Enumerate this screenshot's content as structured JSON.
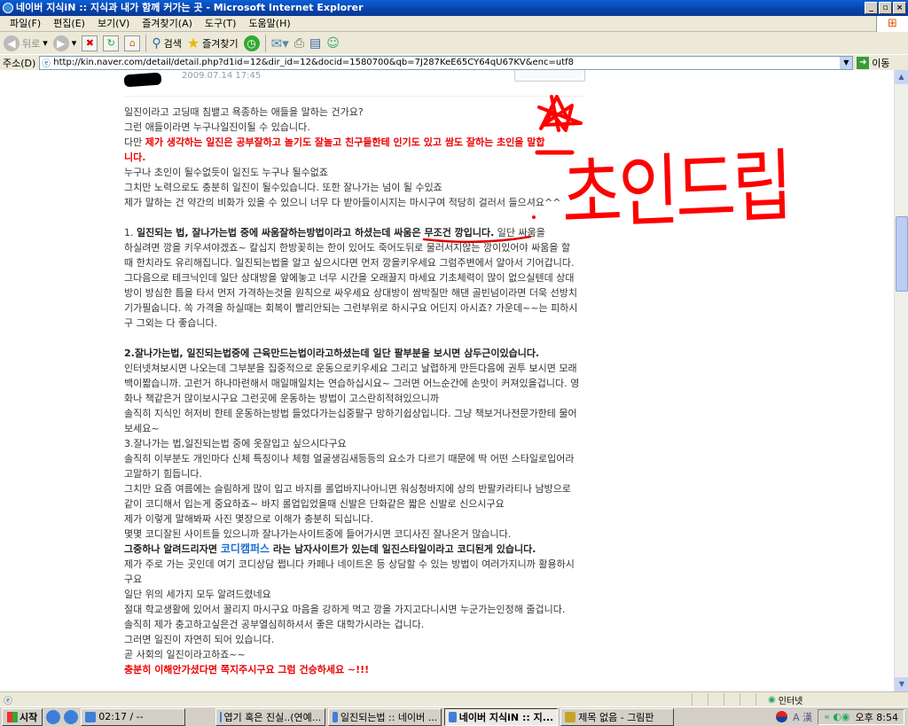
{
  "window": {
    "title": "네이버 지식iN :: 지식과 내가 함께 커가는 곳 - Microsoft Internet Explorer",
    "minimize": "_",
    "maximize": "▫",
    "close": "×"
  },
  "menu": [
    "파일(F)",
    "편집(E)",
    "보기(V)",
    "즐겨찾기(A)",
    "도구(T)",
    "도움말(H)"
  ],
  "toolbar": {
    "back": "뒤로",
    "search": "검색",
    "favorites": "즐겨찾기"
  },
  "address": {
    "label": "주소(D)",
    "url": "http://kin.naver.com/detail/detail.php?d1id=12&dir_id=12&docid=1580700&qb=7J287KeE65CY64qU67KV&enc=utf8",
    "go": "이동"
  },
  "answer": {
    "date": "2009.07.14 17:45",
    "lines": [
      [
        {
          "t": "일진이라고 고딩때 침뱉고 욕종하는 애들을 말하는 건가요?"
        }
      ],
      [
        {
          "t": "그런 애들이라면 누구나일진이될 수 있습니다."
        }
      ],
      [
        {
          "t": "다만 "
        },
        {
          "t": "제가 생각하는 일진은 공부잘하고 놀기도 잘놀고 친구들한테 인기도 있고 쌈도 잘하는 초인을 말합",
          "s": "red"
        }
      ],
      [
        {
          "t": "니다.",
          "s": "red"
        }
      ],
      [
        {
          "t": "누구나 초인이 될수없듯이 일진도 누구나 될수없죠"
        }
      ],
      [
        {
          "t": "그치만 노력으로도 충분히 일진이 될수있습니다. 또한 잘나가는 넘이 될 수있죠"
        }
      ],
      [
        {
          "t": "제가 말하는 건 약간의 비화가 있을 수 있으니 너무 다 받아들이시지는 마시구여 적당히 걸러서 들으셔요^^"
        }
      ],
      [],
      [
        {
          "t": "1. "
        },
        {
          "t": "일진되는 법, 잘나가는법 중에 싸움잘하는방법이라고 하셨는데 싸움은 무조건 깡입니다.",
          "s": "b"
        },
        {
          "t": " 일단 싸움을"
        }
      ],
      [
        {
          "t": "하실려면 깡을 키우셔야겠죠~ 칼십지 한방꽂히는 한이 있어도 죽어도뒤로 물러서지않는 깡이있어야 싸움을 할"
        }
      ],
      [
        {
          "t": "때 한치라도 유리해집니다. 일진되는법을 알고 싶으시다면 먼저 깡을키우세요 그럼주변에서 알아서 기어갑니다."
        }
      ],
      [
        {
          "t": "그다음으로 테크닉인데 일단 상대방을 앞에놓고 너무 시간을 오래끌지 마세요 기초체력이 많이 없으실텐데 상대"
        }
      ],
      [
        {
          "t": "방이 방심한 틈을 타서 먼저 가격하는것을 원칙으로 싸우세요 상대방이 쌈박질만 해댄 골빈넘이라면 더욱 선방치"
        }
      ],
      [
        {
          "t": "기가필숩니다. 쏙 가격을 하실때는 회복이 빨리안되는 그런부위로 하시구요 어딘지 아시죠? 가운데~~는 피하시"
        }
      ],
      [
        {
          "t": "구 그외는 다 좋습니다."
        }
      ],
      [],
      [
        {
          "t": "2.잘나가는법, 일진되는법중에 근육만드는법이라고하셨는데 일단 팔부분을 보시면 삼두근이있습니다.",
          "s": "b"
        }
      ],
      [
        {
          "t": "인터넷쳐보시면 나오는데 그부분을 집중적으로 운동으로키우세요 그리고 날렵하게 만든다음에 권투 보시면 모래"
        }
      ],
      [
        {
          "t": "백이짧습니까. 고런거 하나마련해서 매일매일치는 연습하십시요~ 그러면 어느순간에 손맛이 커져있을겁니다. 영"
        }
      ],
      [
        {
          "t": "화나 책같은거 많이보시구요 그런곳에 운동하는 방법이 고스란히적혀있으니까"
        }
      ],
      [
        {
          "t": "솔직히 지식인 허저비 한테 운동하는방법 들었다가는십중팔구 망하기쉽상입니다. 그냥 책보거나전문가한테 물어"
        }
      ],
      [
        {
          "t": "보세요~"
        }
      ],
      [
        {
          "t": "3.잘나가는 법,일진되는법 중에 옷잘입고 싶으시다구요"
        }
      ],
      [
        {
          "t": "솔직히 이부분도 개인마다 신체 특징이나 체형 얼굴생김새등등의 요소가 다르기 때문에 딱 어떤 스타일로입어라"
        }
      ],
      [
        {
          "t": "고말하기 힘듭니다."
        }
      ],
      [
        {
          "t": "그치만 요즘 여름에는 슬림하게 많이 입고 바지를 롤업바지나아니면 워싱청바지에 상의 반팔카라티나 남방으로"
        }
      ],
      [
        {
          "t": "같이 코디해서 입는게 중요하죠~ 바지 롤업입었을때 신발은 단화같은 짧은 신발로 신으시구요"
        }
      ],
      [
        {
          "t": "제가 이렇게 말해봐짜 사진 몇장으로 이해가 충분히 되십니다."
        }
      ],
      [
        {
          "t": "몇몇 코디잘된 사이트들 있으니까 잘나가는사이트중에 들어가시면 코디사진 잘나온거 많습니다."
        }
      ],
      [
        {
          "t": "그중하나 알려드리자면 ",
          "s": "b"
        },
        {
          "t": "코디캠퍼스",
          "s": "link"
        },
        {
          "t": " 라는 남자사이트가 있는데 일진스타일이라고 코디된게 있습니다.",
          "s": "b"
        }
      ],
      [
        {
          "t": "제가 주로 가는 곳인데 여기 코디상담 쩝니다 카페나 네이트온 등 상담할 수 있는 방법이 여러가지니까 활용하시"
        }
      ],
      [
        {
          "t": "구요"
        }
      ],
      [
        {
          "t": "일단 위의 세가지 모두 알려드렸네요"
        }
      ],
      [
        {
          "t": "절대 학교생활에 있어서 꿀리지 마시구요 마음을 강하게 먹고 깡을 가지고다니시면 누군가는인정해 줄겁니다."
        }
      ],
      [
        {
          "t": "솔직히 제가 충고하고싶은건 공부열심히하셔서 좋은 대학가시라는 겁니다."
        }
      ],
      [
        {
          "t": "그러면 일진이 자연히 되어 있습니다."
        }
      ],
      [
        {
          "t": "곧 사회의 일진이라고하죠~~"
        }
      ],
      [
        {
          "t": "충분히 이해안가셨다면 쪽지주시구요 그럼 건승하세요 ~!!!",
          "s": "red"
        }
      ]
    ]
  },
  "annotation": {
    "handwritten": "초인드립",
    "color": "#ff0000"
  },
  "status": {
    "zone": "인터넷"
  },
  "taskbar": {
    "start": "시작",
    "tasks": [
      {
        "label": "02:17 / --",
        "active": false
      },
      {
        "label": "엽기 혹은 진실..(연예...",
        "active": false
      },
      {
        "label": "일진되는법 :: 네이버 ...",
        "active": false
      },
      {
        "label": "네이버 지식iN :: 지...",
        "active": true
      },
      {
        "label": "제목 없음 - 그림판",
        "active": false
      }
    ],
    "ime": "A 漢",
    "clock": "오후 8:54"
  }
}
